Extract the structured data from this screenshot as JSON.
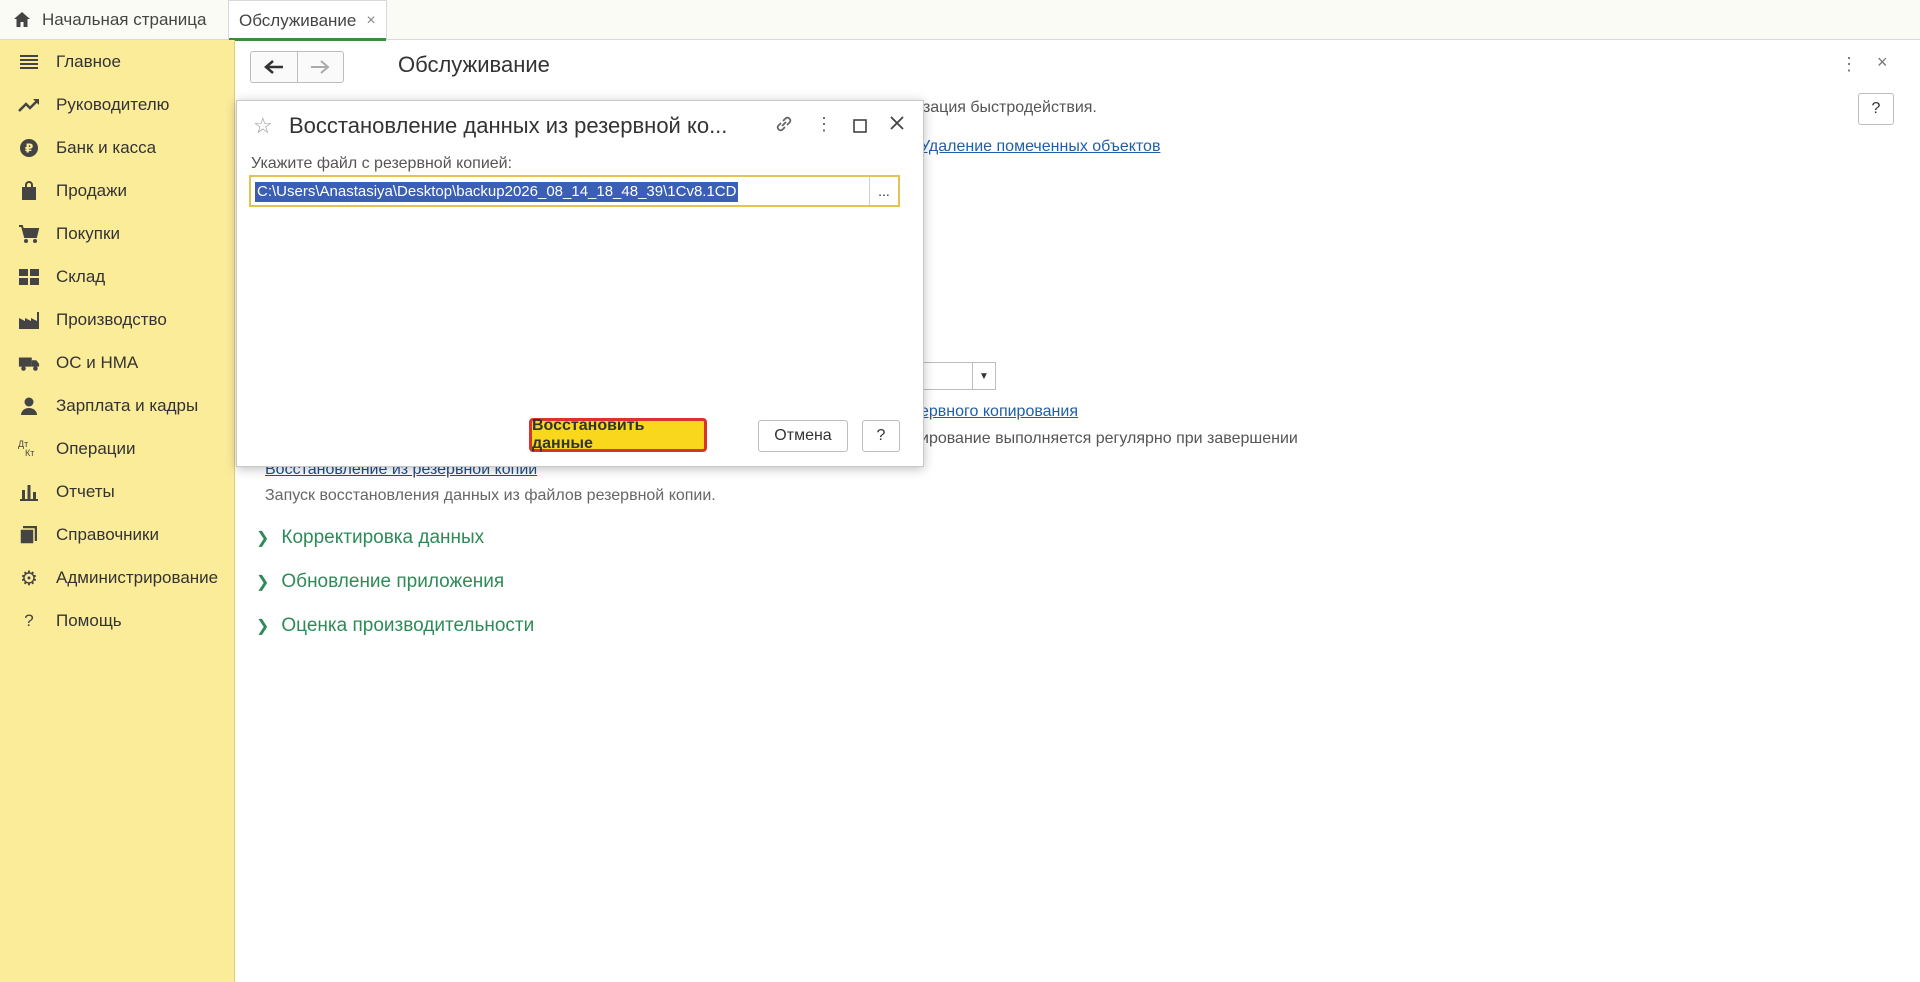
{
  "tabs": {
    "home_label": "Начальная страница",
    "active_label": "Обслуживание",
    "close_glyph": "×"
  },
  "sidebar": {
    "items": [
      {
        "label": "Главное",
        "icon": "menu-icon"
      },
      {
        "label": "Руководителю",
        "icon": "trend-icon"
      },
      {
        "label": "Банк и касса",
        "icon": "ruble-icon"
      },
      {
        "label": "Продажи",
        "icon": "bag-icon"
      },
      {
        "label": "Покупки",
        "icon": "cart-icon"
      },
      {
        "label": "Склад",
        "icon": "warehouse-icon"
      },
      {
        "label": "Производство",
        "icon": "factory-icon"
      },
      {
        "label": "ОС и НМА",
        "icon": "truck-icon"
      },
      {
        "label": "Зарплата и кадры",
        "icon": "person-icon"
      },
      {
        "label": "Операции",
        "icon": "dt-kt-icon"
      },
      {
        "label": "Отчеты",
        "icon": "bar-chart-icon"
      },
      {
        "label": "Справочники",
        "icon": "books-icon"
      },
      {
        "label": "Администрирование",
        "icon": "gear-icon"
      },
      {
        "label": "Помощь",
        "icon": "question-icon"
      }
    ],
    "dt_label": "Дт",
    "kt_label": "Кт",
    "help_glyph": "?"
  },
  "main": {
    "title": "Обслуживание",
    "help_glyph": "?",
    "background": {
      "optimization_text": "мизация быстродействия.",
      "delete_marked_link": "Удаление помеченных объектов",
      "backup_link": "ервного копирования",
      "backup_note": "ирование выполняется регулярно при завершении",
      "restore_link": "Восстановление из резервной копии",
      "restore_desc": "Запуск восстановления данных из файлов резервной копии."
    },
    "sections": [
      {
        "label": "Корректировка данных"
      },
      {
        "label": "Обновление приложения"
      },
      {
        "label": "Оценка производительности"
      }
    ]
  },
  "modal": {
    "title": "Восстановление данных из резервной ко...",
    "field_label": "Укажите файл с резервной копией:",
    "file_path": "C:\\Users\\Anastasiya\\Desktop\\backup2026_08_14_18_48_39\\1Cv8.1CD",
    "browse_label": "...",
    "restore_button": "Восстановить данные",
    "cancel_button": "Отмена",
    "help_button": "?"
  },
  "colors": {
    "sidebar_bg": "#fbec9a",
    "section_green": "#2e8b57",
    "link_blue": "#1f5fa8",
    "primary_button": "#f9d71c",
    "highlight_border": "#d9342b",
    "selection": "#3b5fb5"
  }
}
